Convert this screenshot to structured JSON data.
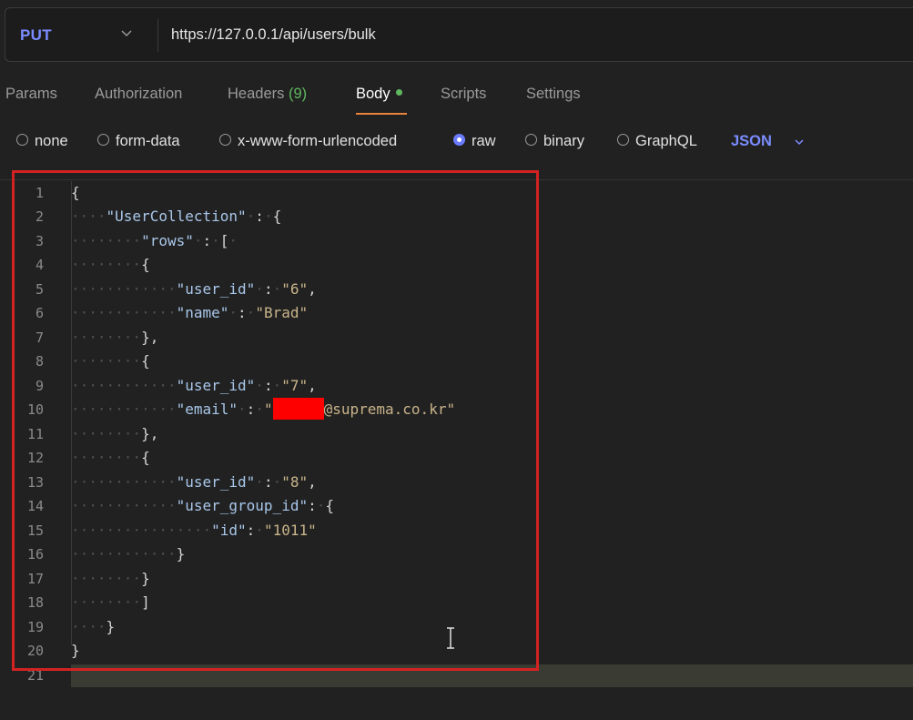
{
  "request": {
    "method": "PUT",
    "url": "https://127.0.0.1/api/users/bulk"
  },
  "tabs": [
    {
      "label": "Params"
    },
    {
      "label": "Authorization"
    },
    {
      "label": "Headers",
      "count": "(9)"
    },
    {
      "label": "Body"
    },
    {
      "label": "Scripts"
    },
    {
      "label": "Settings"
    }
  ],
  "body_types": [
    {
      "label": "none",
      "selected": false
    },
    {
      "label": "form-data",
      "selected": false
    },
    {
      "label": "x-www-form-urlencoded",
      "selected": false
    },
    {
      "label": "raw",
      "selected": true
    },
    {
      "label": "binary",
      "selected": false
    },
    {
      "label": "GraphQL",
      "selected": false
    }
  ],
  "format": "JSON",
  "editor": {
    "line_numbers": [
      "1",
      "2",
      "3",
      "4",
      "5",
      "6",
      "7",
      "8",
      "9",
      "10",
      "11",
      "12",
      "13",
      "14",
      "15",
      "16",
      "17",
      "18",
      "19",
      "20",
      "21"
    ],
    "lines": [
      "{",
      "\"UserCollection\" : {",
      "\"rows\" : [",
      "{",
      "\"user_id\" : \"6\",",
      "\"name\" : \"Brad\"",
      "},",
      "{",
      "\"user_id\" : \"7\",",
      "\"email\" : \"@suprema.co.kr\"",
      "},",
      "{",
      "\"user_id\" : \"8\",",
      "\"user_group_id\": {",
      "\"id\": \"1011\"",
      "}",
      "}",
      "]",
      "}",
      "}"
    ]
  },
  "colors": {
    "accent": "#7a8cff",
    "active_tab_underline": "#e8833a",
    "status_green": "#5fb85f",
    "highlight_border": "#d32222",
    "redaction": "#ff0000"
  }
}
